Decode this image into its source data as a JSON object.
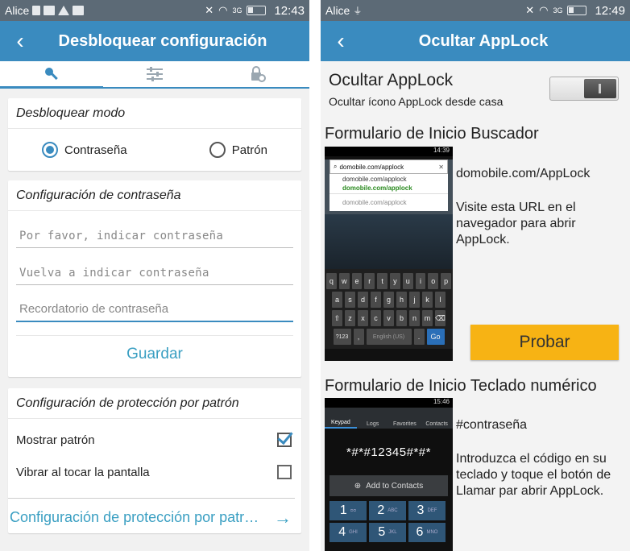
{
  "left": {
    "status": {
      "carrier": "Alice",
      "network": "3G",
      "time": "12:43"
    },
    "header": {
      "title": "Desbloquear configuración"
    },
    "tabs": [
      {
        "icon": "key-icon"
      },
      {
        "icon": "sliders-icon"
      },
      {
        "icon": "lock-gear-icon"
      }
    ],
    "unlock_mode": {
      "title": "Desbloquear modo",
      "options": [
        "Contraseña",
        "Patrón"
      ],
      "selected": "Contraseña"
    },
    "password_config": {
      "title": "Configuración de contraseña",
      "password_placeholder": "Por favor, indicar contraseña",
      "confirm_placeholder": "Vuelva a indicar contraseña",
      "reminder_placeholder": "Recordatorio de contraseña",
      "save_label": "Guardar"
    },
    "pattern_config": {
      "title": "Configuración de protección por patrón",
      "show_pattern": "Mostrar patrón",
      "vibrate": "Vibrar al tocar la pantalla",
      "link": "Configuración de protección por patr…"
    }
  },
  "right": {
    "status": {
      "carrier": "Alice",
      "network": "3G",
      "time": "12:49"
    },
    "header": {
      "title": "Ocultar AppLock"
    },
    "hide": {
      "title": "Ocultar AppLock",
      "subtitle": "Ocultar ícono AppLock desde casa"
    },
    "browser_section": {
      "title": "Formulario de Inicio Buscador",
      "url": "domobile.com/AppLock",
      "desc": "Visite esta URL en el navegador para abrir AppLock.",
      "button": "Probar",
      "shot": {
        "time": "14:39",
        "url": "domobile.com/applock",
        "sugg1": "domobile.com/applock",
        "sugg1b": "domobile.com/applock",
        "sugg2": "domobile.com/applock",
        "keys_row1": [
          "q",
          "w",
          "e",
          "r",
          "t",
          "y",
          "u",
          "i",
          "o",
          "p"
        ],
        "keys_row2": [
          "a",
          "s",
          "d",
          "f",
          "g",
          "h",
          "j",
          "k",
          "l"
        ],
        "keys_row3": [
          "⇧",
          "z",
          "x",
          "c",
          "v",
          "b",
          "n",
          "m",
          "⌫"
        ],
        "key_sym": "?123",
        "key_comma": ",",
        "key_space": "English (US)",
        "key_dot": ".",
        "key_go": "Go"
      }
    },
    "dialer_section": {
      "title": "Formulario de Inicio Teclado numérico",
      "code": "#contraseña",
      "desc": "Introduzca el código en su teclado y toque el botón de Llamar par abrir AppLock.",
      "shot": {
        "time": "15:46",
        "tabs": [
          "Keypad",
          "Logs",
          "Favorites",
          "Contacts"
        ],
        "number": "*#*#12345#*#*",
        "add": "Add to Contacts",
        "keys": [
          {
            "d": "1",
            "l": "ᴑᴑ"
          },
          {
            "d": "2",
            "l": "ABC"
          },
          {
            "d": "3",
            "l": "DEF"
          },
          {
            "d": "4",
            "l": "GHI"
          },
          {
            "d": "5",
            "l": "JKL"
          },
          {
            "d": "6",
            "l": "MNO"
          }
        ]
      }
    }
  }
}
